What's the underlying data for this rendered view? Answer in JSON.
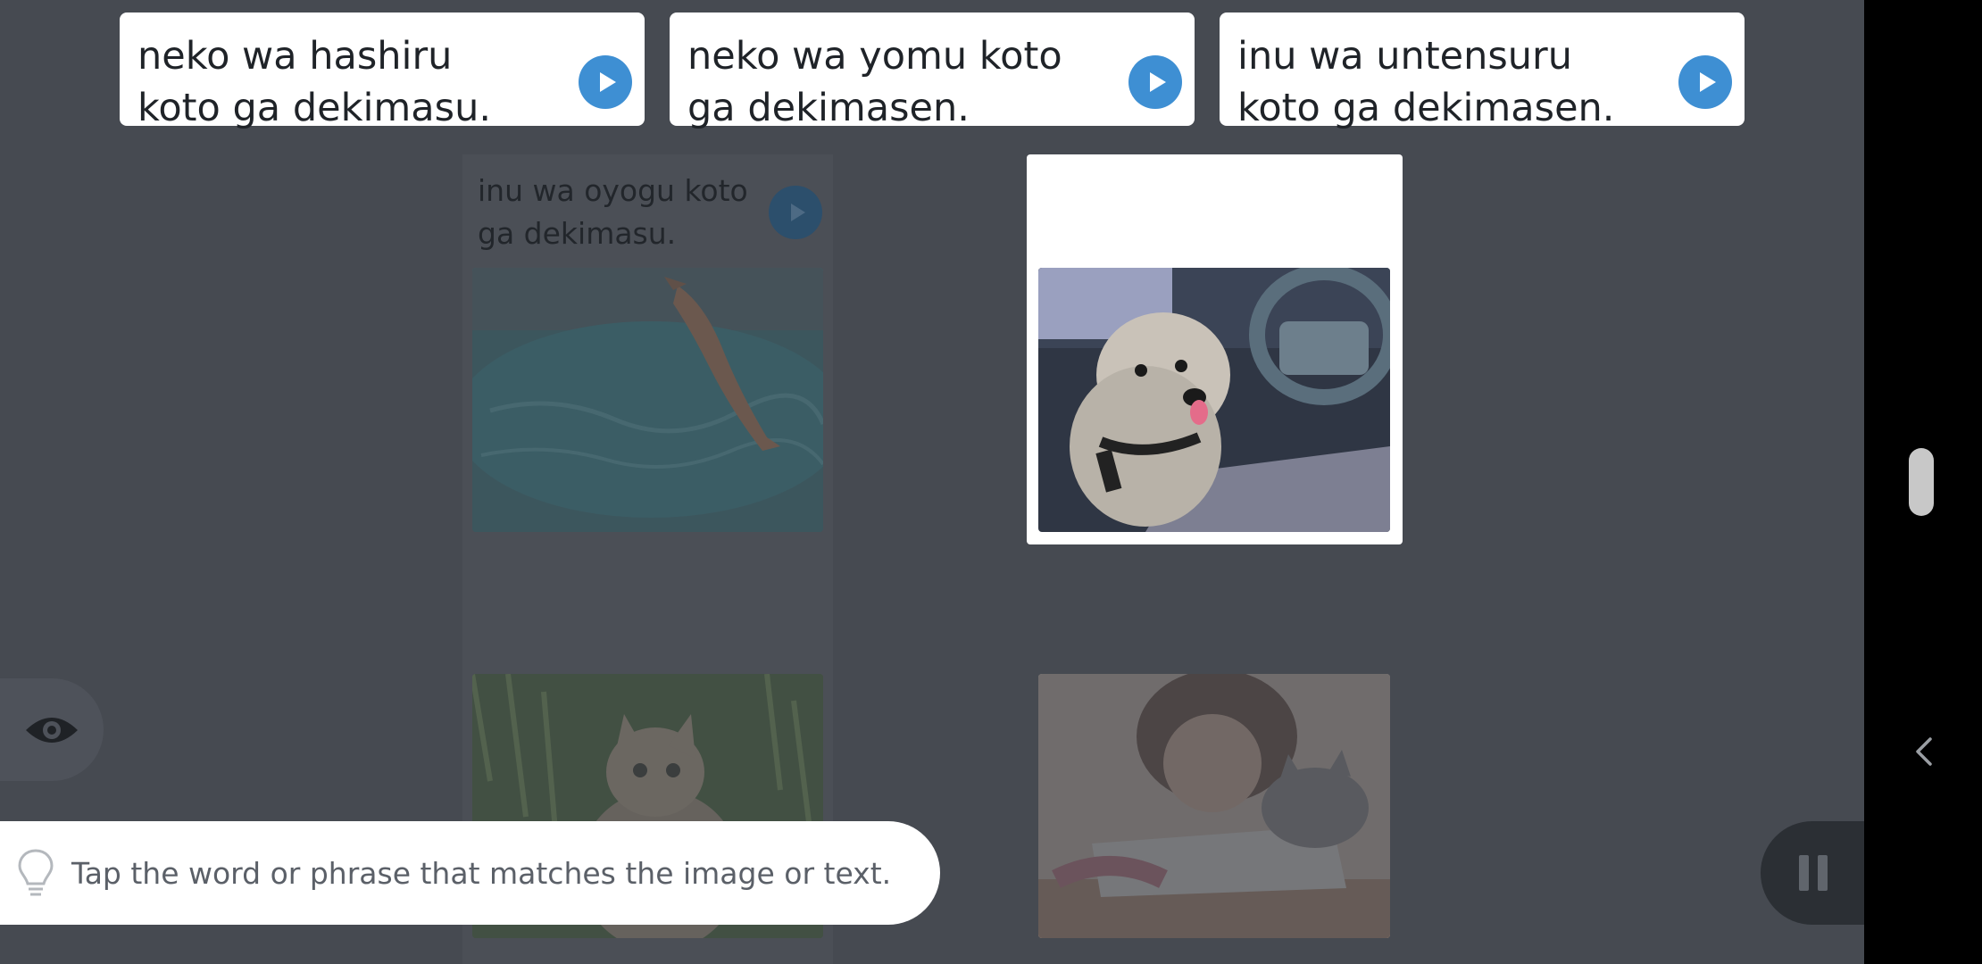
{
  "choices": [
    {
      "text": "neko wa hashiru koto ga dekimasu.",
      "play_icon": "play-icon"
    },
    {
      "text": "neko wa yomu koto ga dekimasen.",
      "play_icon": "play-icon"
    },
    {
      "text": "inu wa untensuru koto ga dekimasen.",
      "play_icon": "play-icon"
    }
  ],
  "grid": {
    "matched_tile_text": "inu wa oyogu koto ga dekimasu.",
    "tiles": [
      {
        "image": "dog-jumping-into-pool",
        "state": "matched"
      },
      {
        "image": "dog-in-car-driver-seat",
        "state": "selected"
      },
      {
        "image": "cat-in-grass",
        "state": "dimmed"
      },
      {
        "image": "girl-reading-with-cat",
        "state": "dimmed"
      }
    ]
  },
  "hint": {
    "icon": "lightbulb-icon",
    "text": "Tap the word or phrase that matches the image or text."
  },
  "controls": {
    "eye_icon": "eye-icon",
    "pause_icon": "pause-icon",
    "back_icon": "chevron-left-icon"
  },
  "colors": {
    "background": "#464a51",
    "card": "#ffffff",
    "play_button": "#3e8fd3",
    "pause_bg": "#2b2f34"
  }
}
